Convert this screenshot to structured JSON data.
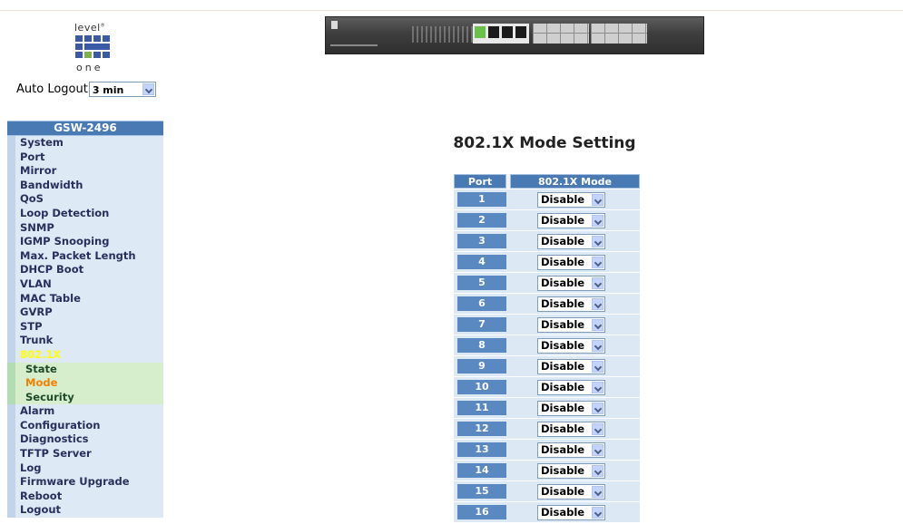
{
  "header": {
    "logo_top": "level",
    "logo_bottom": "one",
    "auto_logout_label": "Auto Logout",
    "auto_logout_value": "3 min"
  },
  "sidebar": {
    "title": "GSW-2496",
    "items": [
      {
        "label": "System"
      },
      {
        "label": "Port"
      },
      {
        "label": "Mirror"
      },
      {
        "label": "Bandwidth"
      },
      {
        "label": "QoS"
      },
      {
        "label": "Loop Detection"
      },
      {
        "label": "SNMP"
      },
      {
        "label": "IGMP Snooping"
      },
      {
        "label": "Max. Packet Length"
      },
      {
        "label": "DHCP Boot"
      },
      {
        "label": "VLAN"
      },
      {
        "label": "MAC Table"
      },
      {
        "label": "GVRP"
      },
      {
        "label": "STP"
      },
      {
        "label": "Trunk"
      },
      {
        "label": "802.1X",
        "state": "active"
      },
      {
        "label": "State",
        "sub": true
      },
      {
        "label": "Mode",
        "sub": true,
        "state": "current"
      },
      {
        "label": "Security",
        "sub": true
      },
      {
        "label": "Alarm"
      },
      {
        "label": "Configuration"
      },
      {
        "label": "Diagnostics"
      },
      {
        "label": "TFTP Server"
      },
      {
        "label": "Log"
      },
      {
        "label": "Firmware Upgrade"
      },
      {
        "label": "Reboot"
      },
      {
        "label": "Logout"
      }
    ]
  },
  "main": {
    "title": "802.1X Mode Setting",
    "columns": [
      "Port",
      "802.1X Mode"
    ],
    "rows": [
      {
        "port": "1",
        "mode": "Disable"
      },
      {
        "port": "2",
        "mode": "Disable"
      },
      {
        "port": "3",
        "mode": "Disable"
      },
      {
        "port": "4",
        "mode": "Disable"
      },
      {
        "port": "5",
        "mode": "Disable"
      },
      {
        "port": "6",
        "mode": "Disable"
      },
      {
        "port": "7",
        "mode": "Disable"
      },
      {
        "port": "8",
        "mode": "Disable"
      },
      {
        "port": "9",
        "mode": "Disable"
      },
      {
        "port": "10",
        "mode": "Disable"
      },
      {
        "port": "11",
        "mode": "Disable"
      },
      {
        "port": "12",
        "mode": "Disable"
      },
      {
        "port": "13",
        "mode": "Disable"
      },
      {
        "port": "14",
        "mode": "Disable"
      },
      {
        "port": "15",
        "mode": "Disable"
      },
      {
        "port": "16",
        "mode": "Disable"
      }
    ]
  },
  "colors": {
    "header_blue": "#4a7ab4",
    "menu_bg": "#dde9f4",
    "submenu_bg": "#d6eecc",
    "active_yellow": "#ffff00",
    "current_orange": "#f37f00"
  }
}
